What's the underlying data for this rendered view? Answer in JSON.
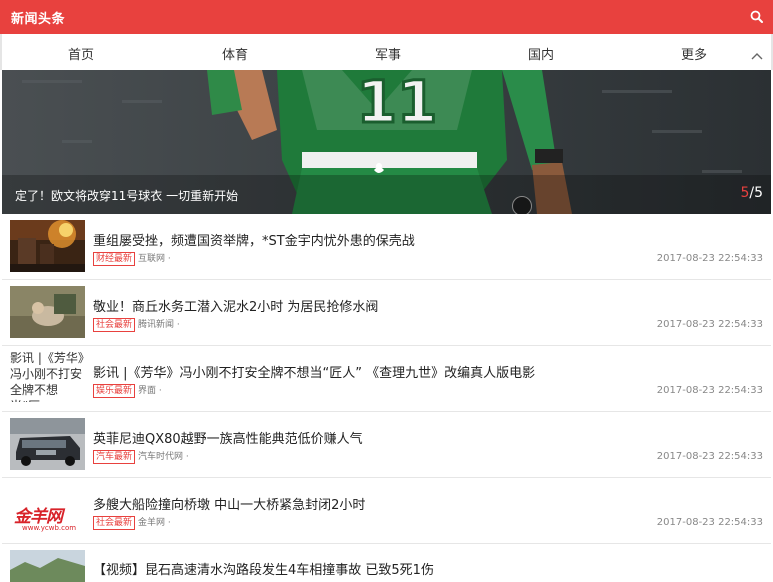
{
  "app": {
    "title": "新闻头条"
  },
  "nav": {
    "items": [
      "首页",
      "体育",
      "军事",
      "国内",
      "更多"
    ]
  },
  "banner": {
    "caption": "定了！欧文将改穿11号球衣 一切重新开始",
    "jersey_number": "11",
    "current": "5",
    "total": "/5"
  },
  "news": [
    {
      "title": "重组屡受挫，频遭国资举牌，*ST金宇内忧外患的保壳战",
      "category": "财经最新",
      "source": "互联网",
      "time": "2017-08-23 22:54:33"
    },
    {
      "title": "敬业！商丘水务工潜入泥水2小时 为居民抢修水阀",
      "category": "社会最新",
      "source": "腾讯新闻",
      "time": "2017-08-23 22:54:33"
    },
    {
      "title": "影讯 |《芳华》冯小刚不打安全牌不想当“匠人” 《查理九世》改编真人版电影",
      "category": "娱乐最新",
      "source": "界面",
      "time": "2017-08-23 22:54:33",
      "thumb_text": "影讯 |《芳华》冯小刚不打安全牌不想当“匠"
    },
    {
      "title": "英菲尼迪QX80越野一族高性能典范低价赚人气",
      "category": "汽车最新",
      "source": "汽车时代网",
      "time": "2017-08-23 22:54:33"
    },
    {
      "title": "多艘大船险撞向桥墩 中山一大桥紧急封闭2小时",
      "category": "社会最新",
      "source": "金羊网",
      "time": "2017-08-23 22:54:33",
      "logo_text": "金羊网",
      "logo_url": "www.ycwb.com"
    },
    {
      "title": "【视频】昆石高速清水沟路段发生4车相撞事故 已致5死1伤"
    }
  ],
  "colors": {
    "accent": "#e8413e"
  },
  "icons": {
    "search": "search-icon",
    "toggle": "chevron-up-icon"
  }
}
